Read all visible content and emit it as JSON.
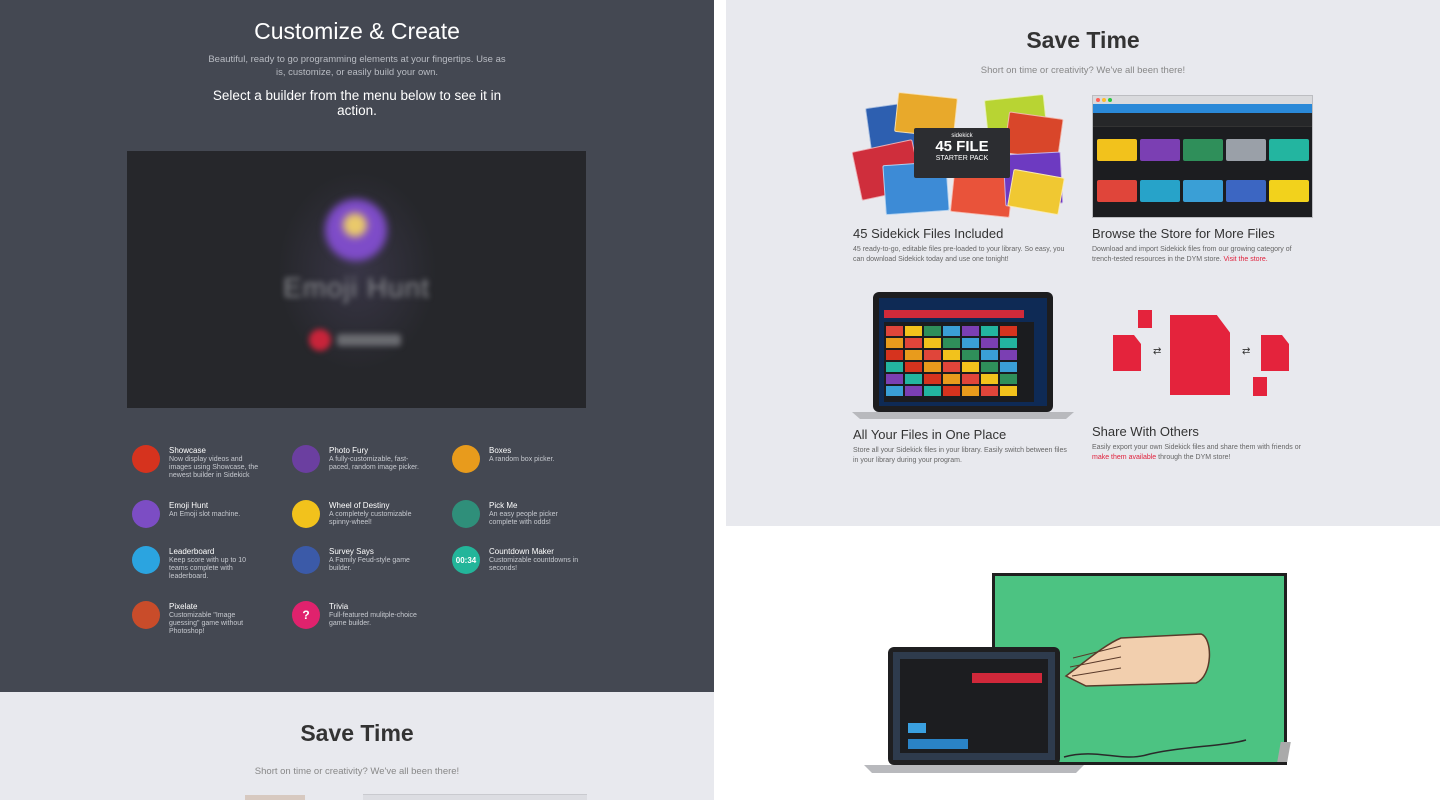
{
  "left": {
    "title": "Customize & Create",
    "subtitle": "Beautiful, ready to go programming elements at your fingertips. Use as is, customize, or easily build your own.",
    "cta": "Select a builder from the menu below to see it in action.",
    "video": {
      "title": "Emoji Hunt"
    },
    "builders": [
      {
        "name": "Showcase",
        "desc": "Now display videos and images using Showcase, the newest builder in Sidekick",
        "icon": "showcase-icon",
        "color": "#d6331e"
      },
      {
        "name": "Photo Fury",
        "desc": "A fully-customizable, fast-paced, random image picker.",
        "icon": "photo-fury-icon",
        "color": "#6b3fa0"
      },
      {
        "name": "Boxes",
        "desc": "A random box picker.",
        "icon": "boxes-icon",
        "color": "#e89b1c"
      },
      {
        "name": "Emoji Hunt",
        "desc": "An Emoji slot machine.",
        "icon": "emoji-hunt-icon",
        "color": "#7c4dc4"
      },
      {
        "name": "Wheel of Destiny",
        "desc": "A completely customizable spinny-wheel!",
        "icon": "wheel-icon",
        "color": "#f2c21c"
      },
      {
        "name": "Pick Me",
        "desc": "An easy people picker complete with odds!",
        "icon": "pick-me-icon",
        "color": "#2f8f7a"
      },
      {
        "name": "Leaderboard",
        "desc": "Keep score with up to 10 teams complete with leaderboard.",
        "icon": "leaderboard-icon",
        "color": "#2ba4e0"
      },
      {
        "name": "Survey Says",
        "desc": "A Family Feud-style game builder.",
        "icon": "survey-icon",
        "color": "#3b5aa8"
      },
      {
        "name": "Countdown Maker",
        "desc": "Customizable countdowns in seconds!",
        "icon": "countdown-icon",
        "color": "#23b59a",
        "label": "00:34"
      },
      {
        "name": "Pixelate",
        "desc": "Customizable \"Image guessing\" game without Photoshop!",
        "icon": "pixelate-icon",
        "color": "#c94c2a"
      },
      {
        "name": "Trivia",
        "desc": "Full-featured mulitple-choice game builder.",
        "icon": "trivia-icon",
        "color": "#e0226d",
        "label": "?"
      }
    ]
  },
  "left_bottom": {
    "title": "Save Time",
    "subtitle": "Short on time or creativity? We've all been there!"
  },
  "right_top": {
    "title": "Save Time",
    "subtitle": "Short on time or creativity? We've all been there!",
    "features": [
      {
        "title": "45 Sidekick Files Included",
        "desc": "45 ready-to-go, editable files pre-loaded to your library. So easy, you can download Sidekick today and use one tonight!"
      },
      {
        "title": "Browse the Store for More Files",
        "desc": "Download and import Sidekick files from our growing category of trench-tested resources in the DYM store.",
        "link": "Visit the store."
      },
      {
        "title": "All Your Files in One Place",
        "desc": "Store all your Sidekick files in your library. Easily switch between files in your library during your program."
      },
      {
        "title": "Share With Others",
        "desc_before": "Easily export your own Sidekick files and share them with friends or",
        "link": "make them available",
        "desc_after": "through the DYM store!"
      }
    ],
    "badge": {
      "brand": "sidekick",
      "big": "45 FILE",
      "small": "STARTER PACK"
    }
  }
}
